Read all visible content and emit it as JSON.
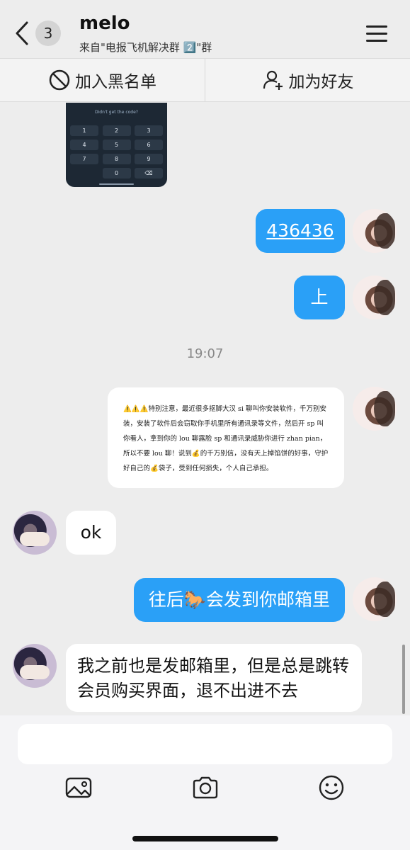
{
  "header": {
    "unread_count": "3",
    "title": "melo",
    "subtitle": "来自\"电报飞机解决群 2️⃣\"群"
  },
  "actions": {
    "block_label": "加入黑名单",
    "add_friend_label": "加为好友"
  },
  "phone_screenshot": {
    "question": "Didn't get the code?",
    "keys": [
      {
        "digit": "1",
        "letters": ""
      },
      {
        "digit": "2",
        "letters": "ABC"
      },
      {
        "digit": "3",
        "letters": "DEF"
      },
      {
        "digit": "4",
        "letters": "GHI"
      },
      {
        "digit": "5",
        "letters": "JKL"
      },
      {
        "digit": "6",
        "letters": "MNO"
      },
      {
        "digit": "7",
        "letters": "PQRS"
      },
      {
        "digit": "8",
        "letters": "TUV"
      },
      {
        "digit": "9",
        "letters": "WXYZ"
      },
      {
        "digit": "0",
        "letters": "+"
      }
    ]
  },
  "messages": [
    {
      "side": "out",
      "text": "436436",
      "link": true
    },
    {
      "side": "out",
      "text": "上"
    },
    {
      "type": "time",
      "text": "19:07"
    },
    {
      "side": "out",
      "type": "notice",
      "text": "⚠️⚠️⚠️特别注意，最近很多抠脚大汉 si 聊叫你安装软件，千万别安装，安装了软件后会窃取你手机里所有通讯录等文件，然后开 sp 叫你看人，拿到你的 lou 聊露脸 sp 和通讯录威胁你进行 zhan pian，所以不要 lou 聊！说到💰的千万别信，没有天上掉馅饼的好事，守护好自己的💰袋子，受到任何损失，个人自己承担。"
    },
    {
      "side": "in",
      "text": "ok"
    },
    {
      "side": "out",
      "text": "往后🐎会发到你邮箱里"
    },
    {
      "side": "in",
      "text": "我之前也是发邮箱里，但是总是跳转会员购买界面，退不出进不去"
    }
  ],
  "input": {
    "placeholder": ""
  },
  "toolbar": {
    "icons": [
      "image-icon",
      "camera-icon",
      "emoji-icon"
    ]
  },
  "colors": {
    "outgoing_bubble": "#2aa0f7",
    "incoming_bubble": "#ffffff",
    "background": "#ededed"
  }
}
